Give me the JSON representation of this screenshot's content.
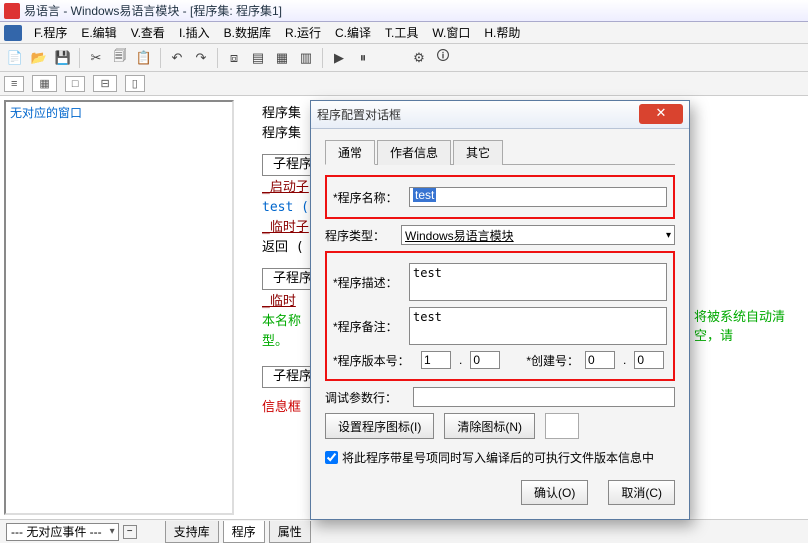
{
  "title": "易语言 - Windows易语言模块 - [程序集: 程序集1]",
  "menu": [
    "F.程序",
    "E.编辑",
    "V.查看",
    "I.插入",
    "B.数据库",
    "R.运行",
    "C.编译",
    "T.工具",
    "W.窗口",
    "H.帮助"
  ],
  "toolbar2": {
    "btn1": "≡",
    "btn2": "▦",
    "btn3": "□",
    "btn4": "⊟",
    "btn5": "▯"
  },
  "left_panel": {
    "caption": "无对应的窗口"
  },
  "code": {
    "l1": "程序集",
    "l2": "程序集",
    "sub1": "子程序",
    "start": "_启动子",
    "test": "test (",
    "temp_sub": "_临时子",
    "ret": "返回 (",
    "sub2": "子程序",
    "temp2": "_临时",
    "hint1": "本名称",
    "hint2": "型。",
    "sub3": "子程序",
    "msgbox": "信息框"
  },
  "side_hint": "将被系统自动清空，请",
  "bottom": {
    "combo": "--- 无对应事件 ---",
    "tab1": "支持库",
    "tab2": "程序",
    "tab3": "属性"
  },
  "dialog": {
    "title": "程序配置对话框",
    "tabs": [
      "通常",
      "作者信息",
      "其它"
    ],
    "lbl_name": "*程序名称：",
    "val_name": "test",
    "lbl_type": "程序类型：",
    "val_type": "Windows易语言模块",
    "lbl_desc": "*程序描述：",
    "val_desc": "test",
    "lbl_note": "*程序备注：",
    "val_note": "test",
    "lbl_ver": "*程序版本号：",
    "ver_a": "1",
    "ver_b": "0",
    "lbl_build": "*创建号：",
    "build_a": "0",
    "build_b": "0",
    "lbl_debug": "调试参数行：",
    "btn_seticon": "设置程序图标(I)",
    "btn_clricon": "清除图标(N)",
    "checkbox": "将此程序带星号项同时写入编译后的可执行文件版本信息中",
    "btn_ok": "确认(O)",
    "btn_cancel": "取消(C)"
  }
}
